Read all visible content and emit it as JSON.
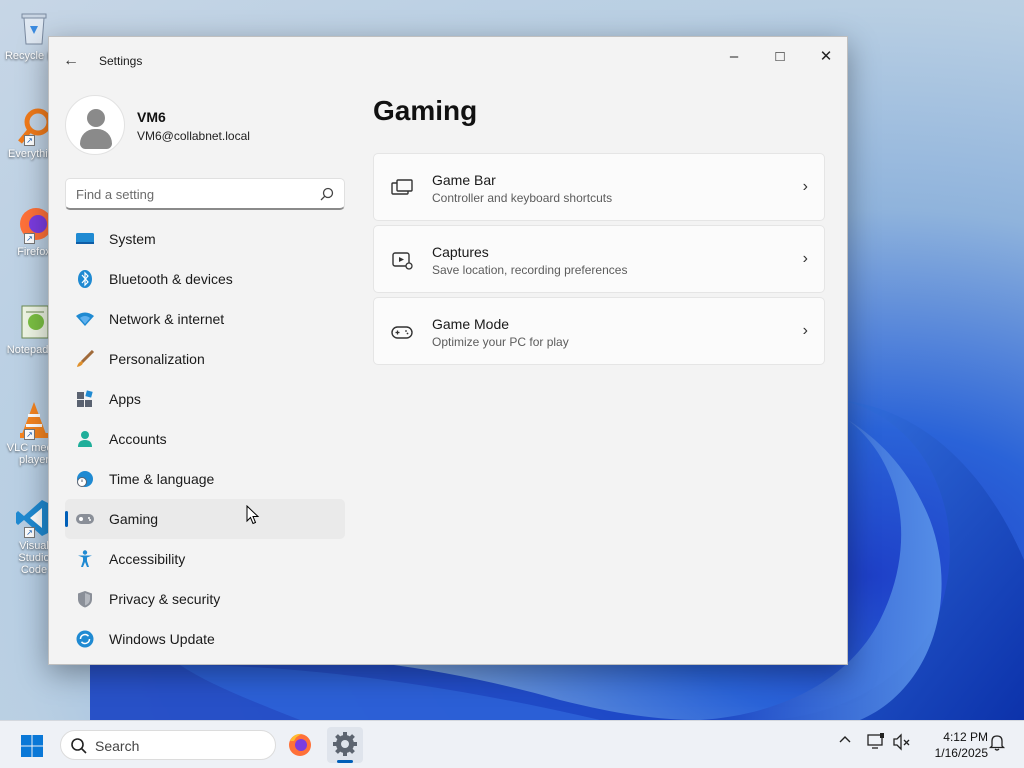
{
  "desktop": {
    "icons": [
      {
        "label": "Recycle Bin",
        "icon": "recycle-bin-icon"
      },
      {
        "label": "Everything",
        "icon": "everything-search-icon"
      },
      {
        "label": "Firefox",
        "icon": "firefox-icon"
      },
      {
        "label": "Notepad++",
        "icon": "notepad-plus-plus-icon"
      },
      {
        "label": "VLC media player",
        "icon": "vlc-icon"
      },
      {
        "label": "Visual Studio Code",
        "icon": "vscode-icon"
      }
    ]
  },
  "window": {
    "title": "Settings",
    "controls": {
      "minimize": "–",
      "maximize": "□",
      "close": "✕"
    }
  },
  "profile": {
    "name": "VM6",
    "email": "VM6@collabnet.local"
  },
  "search": {
    "placeholder": "Find a setting"
  },
  "nav": {
    "items": [
      {
        "label": "System",
        "icon": "system-monitor-icon"
      },
      {
        "label": "Bluetooth & devices",
        "icon": "bluetooth-icon"
      },
      {
        "label": "Network & internet",
        "icon": "wifi-icon"
      },
      {
        "label": "Personalization",
        "icon": "paintbrush-icon"
      },
      {
        "label": "Apps",
        "icon": "apps-icon"
      },
      {
        "label": "Accounts",
        "icon": "account-icon"
      },
      {
        "label": "Time & language",
        "icon": "globe-clock-icon"
      },
      {
        "label": "Gaming",
        "icon": "game-controller-icon",
        "selected": true
      },
      {
        "label": "Accessibility",
        "icon": "accessibility-icon"
      },
      {
        "label": "Privacy & security",
        "icon": "shield-icon"
      },
      {
        "label": "Windows Update",
        "icon": "update-icon"
      }
    ]
  },
  "main": {
    "title": "Gaming",
    "cards": [
      {
        "title": "Game Bar",
        "subtitle": "Controller and keyboard shortcuts",
        "icon": "game-bar-icon"
      },
      {
        "title": "Captures",
        "subtitle": "Save location, recording preferences",
        "icon": "captures-icon"
      },
      {
        "title": "Game Mode",
        "subtitle": "Optimize your PC for play",
        "icon": "game-mode-icon"
      }
    ]
  },
  "taskbar": {
    "search_placeholder": "Search",
    "time": "4:12 PM",
    "date": "1/16/2025",
    "apps": [
      "firefox-icon",
      "settings-gear-icon"
    ]
  },
  "colors": {
    "accent": "#005fb8",
    "window_bg": "#f3f3f3",
    "card_bg": "#fbfbfb"
  }
}
